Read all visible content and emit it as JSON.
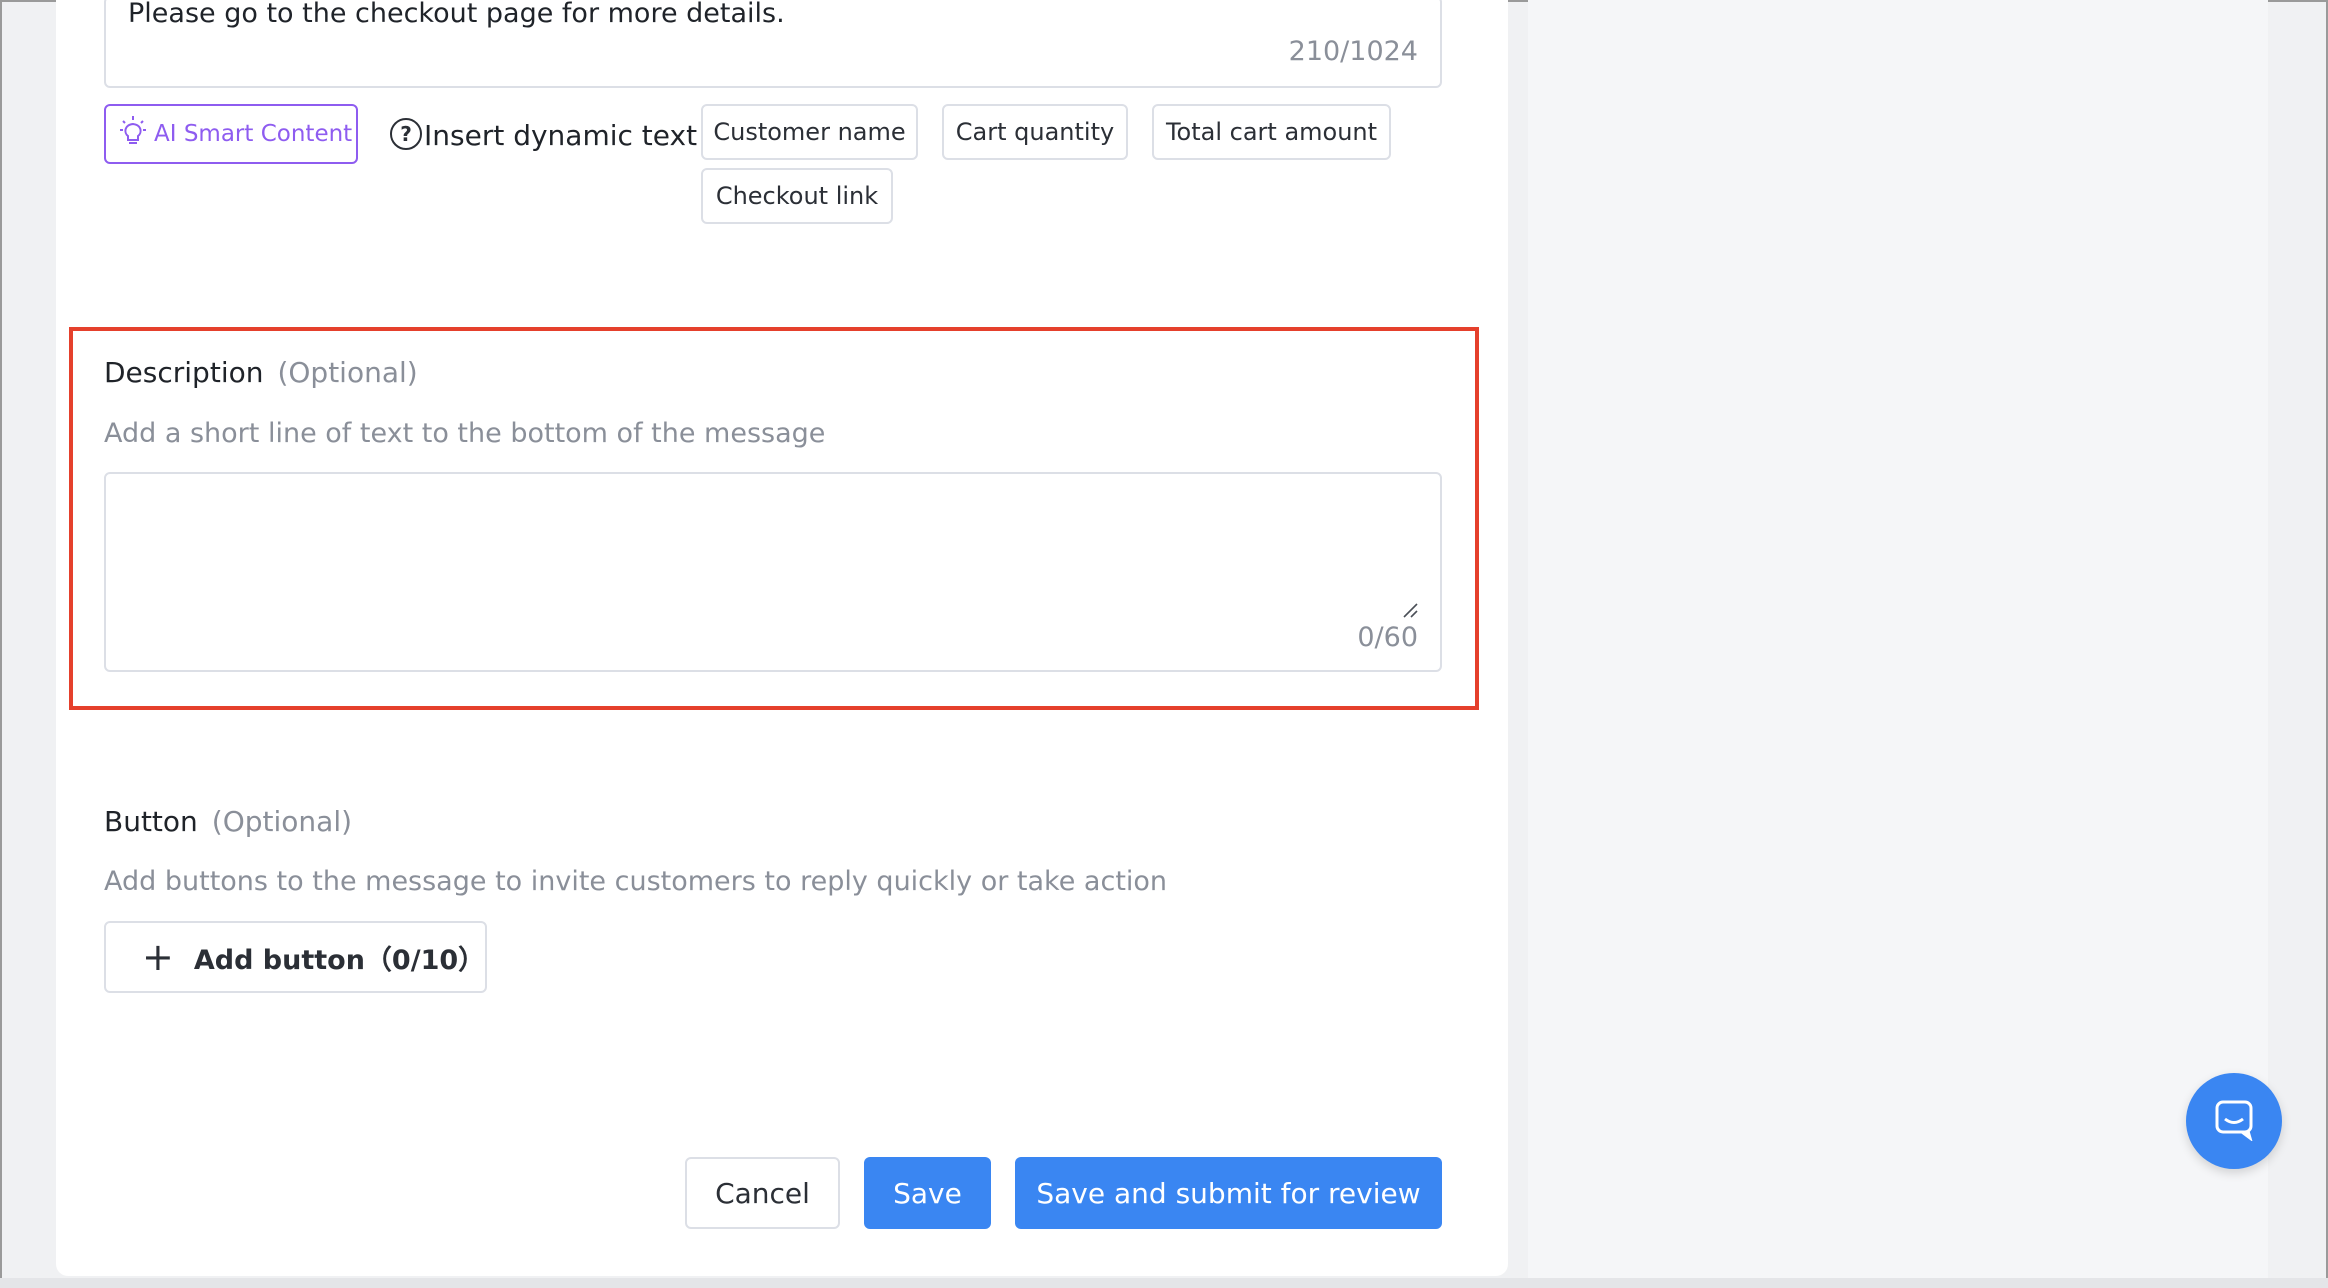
{
  "content": {
    "text": "Please go to the checkout page for more details.",
    "counter": "210/1024"
  },
  "ai_button": {
    "label": "AI Smart Content",
    "icon": "lightbulb-icon"
  },
  "dynamic_text": {
    "label": "Insert dynamic text：",
    "tags": [
      "Customer name",
      "Cart quantity",
      "Total cart amount",
      "Checkout link"
    ]
  },
  "description": {
    "title": "Description",
    "optional": "(Optional)",
    "hint": "Add a short line of text to the bottom of the message",
    "value": "",
    "counter": "0/60"
  },
  "button_section": {
    "title": "Button",
    "optional": "(Optional)",
    "hint": "Add buttons to the message to invite customers to reply quickly or take action",
    "add_label": "Add button（0/10）"
  },
  "footer": {
    "cancel": "Cancel",
    "save": "Save",
    "submit": "Save and submit for review"
  },
  "colors": {
    "primary": "#3a86f2",
    "ai_accent": "#8e5cf0",
    "highlight": "#e5402c"
  }
}
